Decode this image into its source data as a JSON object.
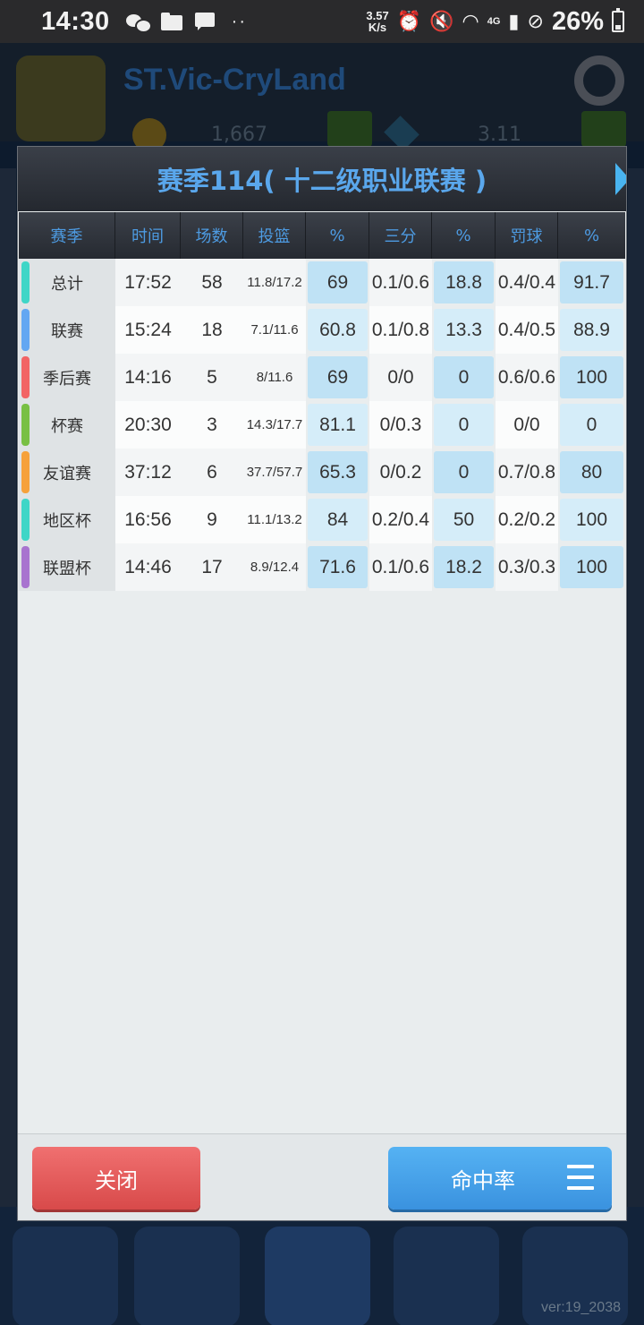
{
  "status_bar": {
    "time": "14:30",
    "speed_value": "3.57",
    "speed_unit": "K/s",
    "network": "4G",
    "battery": "26%"
  },
  "background": {
    "team_name": "ST.Vic-CryLand",
    "money": "1,667",
    "count": "3.11",
    "version": "ver:19_2038"
  },
  "dialog": {
    "title": "赛季114( 十二级职业联赛 )",
    "columns": [
      "赛季",
      "时间",
      "场数",
      "投篮",
      "%",
      "三分",
      "%",
      "罚球",
      "%"
    ],
    "rows": [
      {
        "name": "总计",
        "color": "#3fd6c7",
        "time": "17:52",
        "games": "58",
        "fg": "11.8/17.2",
        "fg_pct": "69",
        "three": "0.1/0.6",
        "three_pct": "18.8",
        "ft": "0.4/0.4",
        "ft_pct": "91.7"
      },
      {
        "name": "联赛",
        "color": "#63a7f2",
        "time": "15:24",
        "games": "18",
        "fg": "7.1/11.6",
        "fg_pct": "60.8",
        "three": "0.1/0.8",
        "three_pct": "13.3",
        "ft": "0.4/0.5",
        "ft_pct": "88.9"
      },
      {
        "name": "季后赛",
        "color": "#f26465",
        "time": "14:16",
        "games": "5",
        "fg": "8/11.6",
        "fg_pct": "69",
        "three": "0/0",
        "three_pct": "0",
        "ft": "0.6/0.6",
        "ft_pct": "100"
      },
      {
        "name": "杯赛",
        "color": "#78c043",
        "time": "20:30",
        "games": "3",
        "fg": "14.3/17.7",
        "fg_pct": "81.1",
        "three": "0/0.3",
        "three_pct": "0",
        "ft": "0/0",
        "ft_pct": "0"
      },
      {
        "name": "友谊赛",
        "color": "#f6a13a",
        "time": "37:12",
        "games": "6",
        "fg": "37.7/57.7",
        "fg_pct": "65.3",
        "three": "0/0.2",
        "three_pct": "0",
        "ft": "0.7/0.8",
        "ft_pct": "80"
      },
      {
        "name": "地区杯",
        "color": "#3fd6c7",
        "time": "16:56",
        "games": "9",
        "fg": "11.1/13.2",
        "fg_pct": "84",
        "three": "0.2/0.4",
        "three_pct": "50",
        "ft": "0.2/0.2",
        "ft_pct": "100"
      },
      {
        "name": "联盟杯",
        "color": "#a873cf",
        "time": "14:46",
        "games": "17",
        "fg": "8.9/12.4",
        "fg_pct": "71.6",
        "three": "0.1/0.6",
        "three_pct": "18.2",
        "ft": "0.3/0.3",
        "ft_pct": "100"
      }
    ],
    "close_label": "关闭",
    "mode_label": "命中率"
  }
}
